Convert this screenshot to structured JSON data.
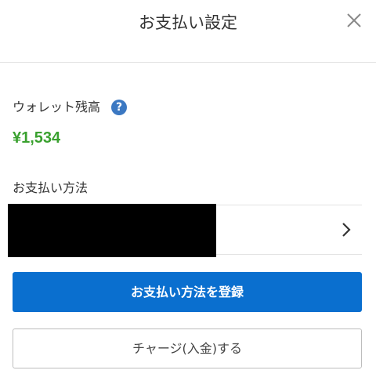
{
  "header": {
    "title": "お支払い設定",
    "close_icon": "close-icon"
  },
  "wallet": {
    "label": "ウォレット残高",
    "help_icon": "?",
    "amount": "¥1,534",
    "amount_color": "#3aa12f"
  },
  "payment_method": {
    "label": "お支払い方法",
    "chevron_icon": "chevron-right-icon"
  },
  "buttons": {
    "register_label": "お支払い方法を登録",
    "register_color": "#0a6fcf",
    "charge_label": "チャージ(入金)する"
  }
}
